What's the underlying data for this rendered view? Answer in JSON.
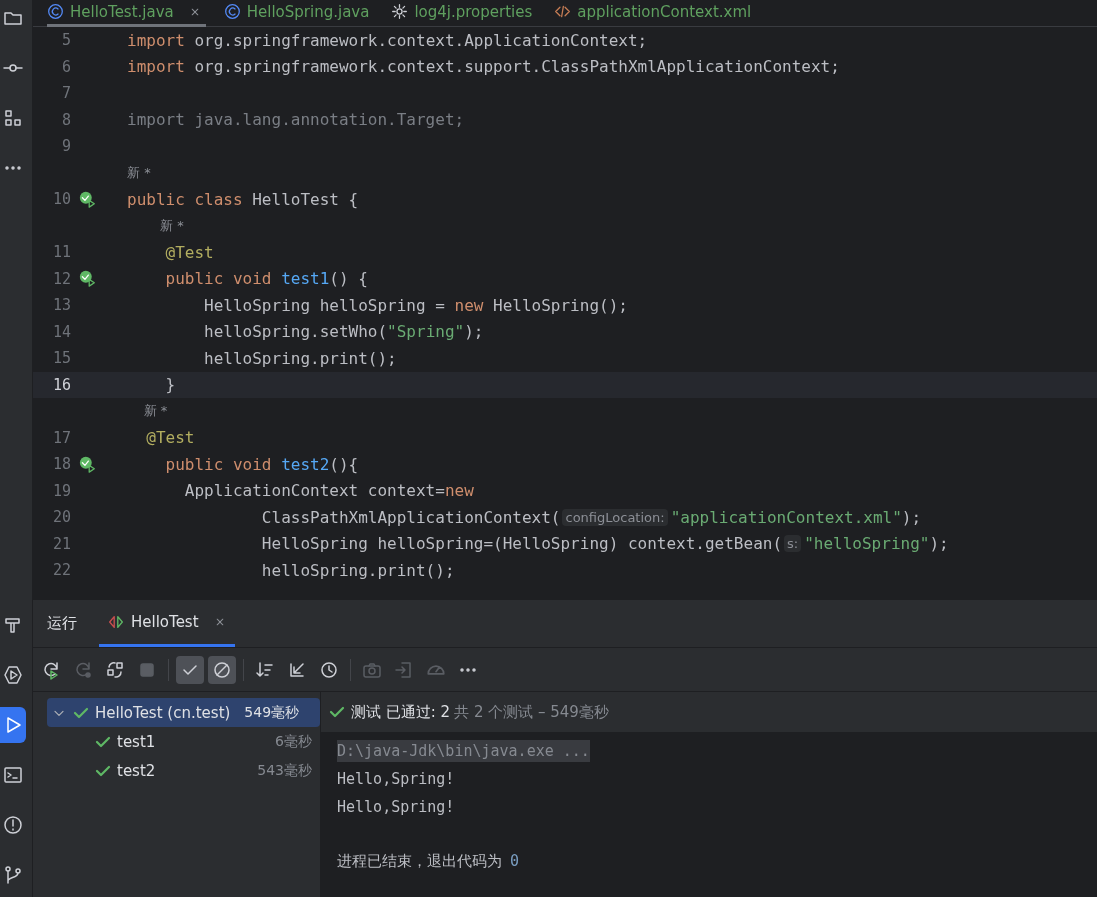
{
  "editor_tabs": [
    {
      "label": "HelloTest.java",
      "selected": true,
      "closable": true
    },
    {
      "label": "HelloSpring.java",
      "selected": false,
      "closable": false
    },
    {
      "label": "log4j.properties",
      "selected": false,
      "closable": false
    },
    {
      "label": "applicationContext.xml",
      "selected": false,
      "closable": false
    }
  ],
  "left_toolbar": {
    "top": [
      {
        "selected": false
      },
      {
        "selected": false
      },
      {
        "selected": false
      },
      {
        "selected": false
      }
    ],
    "bottom": [
      {
        "selected": false
      },
      {
        "selected": false
      },
      {
        "selected": true
      },
      {
        "selected": false
      },
      {
        "selected": false
      },
      {
        "selected": false
      }
    ]
  },
  "code_lines": [
    {
      "number": "5",
      "run_mark": false,
      "current": false,
      "tokens": [
        {
          "kind": "kw",
          "text": "import "
        },
        {
          "kind": "plain",
          "text": "org.springframework.context.ApplicationContext;"
        }
      ]
    },
    {
      "number": "6",
      "run_mark": false,
      "current": false,
      "tokens": [
        {
          "kind": "kw",
          "text": "import "
        },
        {
          "kind": "plain",
          "text": "org.springframework.context.support.ClassPathXmlApplicationContext;"
        }
      ]
    },
    {
      "number": "7",
      "run_mark": false,
      "current": false
    },
    {
      "number": "8",
      "run_mark": false,
      "current": false,
      "tokens": [
        {
          "kind": "dim",
          "text": "import java.lang.annotation.Target;"
        }
      ]
    },
    {
      "number": "9",
      "run_mark": false,
      "current": false
    },
    {
      "number": "10",
      "run_mark": true,
      "current": false,
      "author_hint": "新 *",
      "tokens": [
        {
          "kind": "kw",
          "text": "public class "
        },
        {
          "kind": "plain",
          "text": "HelloTest {"
        }
      ]
    },
    {
      "number": "11",
      "run_mark": false,
      "current": false,
      "author_hint": "新 *",
      "tokens": [
        {
          "kind": "ann",
          "text": "    @Test"
        }
      ]
    },
    {
      "number": "12",
      "run_mark": true,
      "current": false,
      "tokens": [
        {
          "kind": "kw",
          "text": "    public void "
        },
        {
          "kind": "fn",
          "text": "test1"
        },
        {
          "kind": "plain",
          "text": "() {"
        }
      ]
    },
    {
      "number": "13",
      "run_mark": false,
      "current": false,
      "tokens": [
        {
          "kind": "plain",
          "text": "        HelloSpring helloSpring = "
        },
        {
          "kind": "kw",
          "text": "new "
        },
        {
          "kind": "plain",
          "text": "HelloSpring();"
        }
      ]
    },
    {
      "number": "14",
      "run_mark": false,
      "current": false,
      "tokens": [
        {
          "kind": "plain",
          "text": "        helloSpring.setWho("
        },
        {
          "kind": "str",
          "text": "\"Spring\""
        },
        {
          "kind": "plain",
          "text": ");"
        }
      ]
    },
    {
      "number": "15",
      "run_mark": false,
      "current": false,
      "tokens": [
        {
          "kind": "plain",
          "text": "        helloSpring.print();"
        }
      ]
    },
    {
      "number": "16",
      "run_mark": false,
      "current": true,
      "tokens": [
        {
          "kind": "plain",
          "text": "    }"
        }
      ]
    },
    {
      "number": "17",
      "run_mark": false,
      "current": false,
      "author_hint": "新 *",
      "tokens": [
        {
          "kind": "ann",
          "text": "  @Test"
        }
      ]
    },
    {
      "number": "18",
      "run_mark": true,
      "current": false,
      "tokens": [
        {
          "kind": "kw",
          "text": "    public void "
        },
        {
          "kind": "fn",
          "text": "test2"
        },
        {
          "kind": "plain",
          "text": "(){"
        }
      ]
    },
    {
      "number": "19",
      "run_mark": false,
      "current": false,
      "tokens": [
        {
          "kind": "plain",
          "text": "      ApplicationContext context="
        },
        {
          "kind": "kw",
          "text": "new"
        }
      ]
    },
    {
      "number": "20",
      "run_mark": false,
      "current": false,
      "tokens": [
        {
          "kind": "plain",
          "text": "              ClassPathXmlApplicationContext("
        },
        {
          "kind": "hint",
          "text": "configLocation:"
        },
        {
          "kind": "str",
          "text": "\"applicationContext.xml\""
        },
        {
          "kind": "plain",
          "text": ");"
        }
      ]
    },
    {
      "number": "21",
      "run_mark": false,
      "current": false,
      "tokens": [
        {
          "kind": "plain",
          "text": "              HelloSpring helloSpring=(HelloSpring) context.getBean("
        },
        {
          "kind": "hint",
          "text": "s:"
        },
        {
          "kind": "str",
          "text": "\"helloSpring\""
        },
        {
          "kind": "plain",
          "text": ");"
        }
      ]
    },
    {
      "number": "22",
      "run_mark": false,
      "current": false,
      "tokens": [
        {
          "kind": "plain",
          "text": "              helloSpring.print();"
        }
      ]
    }
  ],
  "run_panel": {
    "title": "运行",
    "tabs": [
      {
        "label": "HelloTest",
        "selected": true,
        "closable": true
      }
    ],
    "toolbar": [
      {
        "disabled": false,
        "selected": false
      },
      {
        "disabled": true,
        "selected": false
      },
      {
        "disabled": false,
        "selected": false
      },
      {
        "disabled": true,
        "selected": false
      },
      {
        "disabled": false,
        "selected": true
      },
      {
        "disabled": false,
        "selected": true
      },
      {
        "disabled": false,
        "selected": false
      },
      {
        "disabled": false,
        "selected": false
      },
      {
        "disabled": false,
        "selected": false
      },
      {
        "disabled": true,
        "selected": false
      },
      {
        "disabled": true,
        "selected": false
      },
      {
        "disabled": true,
        "selected": false
      },
      {
        "disabled": false,
        "selected": false
      }
    ],
    "tree": [
      {
        "name": "HelloTest (cn.test)",
        "time": "549毫秒",
        "passed": true,
        "expanded": true,
        "selected": true,
        "children": [
          {
            "name": "test1",
            "time": "6毫秒",
            "passed": true,
            "selected": false
          },
          {
            "name": "test2",
            "time": "543毫秒",
            "passed": true,
            "selected": false
          }
        ]
      }
    ],
    "status": {
      "passed": true,
      "summary": "测试 已通过: 2",
      "detail": "共 2 个测试 – 549毫秒"
    },
    "console": [
      {
        "kind": "command",
        "text": "D:\\java-Jdk\\bin\\java.exe ..."
      },
      {
        "kind": "output",
        "text": "Hello,Spring!"
      },
      {
        "kind": "output",
        "text": "Hello,Spring!"
      },
      {
        "kind": "exit",
        "text": "进程已结束，退出代码为",
        "code": "0"
      }
    ]
  }
}
